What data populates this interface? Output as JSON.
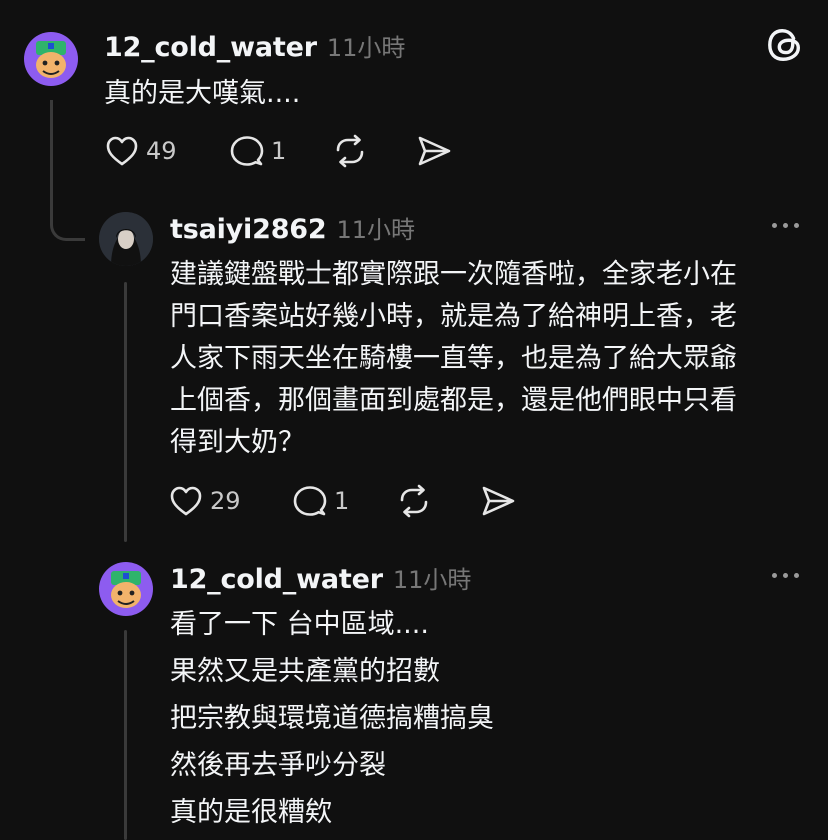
{
  "posts": [
    {
      "username": "12_cold_water",
      "time": "11小時",
      "lines": [
        "真的是大嘆氣...."
      ],
      "likes": "49",
      "replies": "1"
    },
    {
      "username": "tsaiyi2862",
      "time": "11小時",
      "lines": [
        "建議鍵盤戰士都實際跟一次隨香啦，全家老小在",
        "門口香案站好幾小時，就是為了給神明上香，老",
        "人家下雨天坐在騎樓一直等，也是為了給大眾爺",
        "上個香，那個畫面到處都是，還是他們眼中只看",
        "得到大奶？"
      ],
      "likes": "29",
      "replies": "1"
    },
    {
      "username": "12_cold_water",
      "time": "11小時",
      "lines": [
        "看了一下 台中區域....",
        "果然又是共產黨的招數",
        "把宗教與環境道德搞糟搞臭",
        "然後再去爭吵分裂",
        "真的是很糟欸"
      ]
    }
  ],
  "icons": {
    "threads_logo": "threads-logo-icon",
    "like": "heart-icon",
    "reply": "comment-icon",
    "repost": "repost-icon",
    "share": "send-icon",
    "more": "more-dots-icon"
  },
  "colors": {
    "background": "#101010",
    "text": "#f3f5f7",
    "secondary": "#777777",
    "thread_line": "#3a3a3a",
    "avatar_purple": "#8d5cf0"
  }
}
